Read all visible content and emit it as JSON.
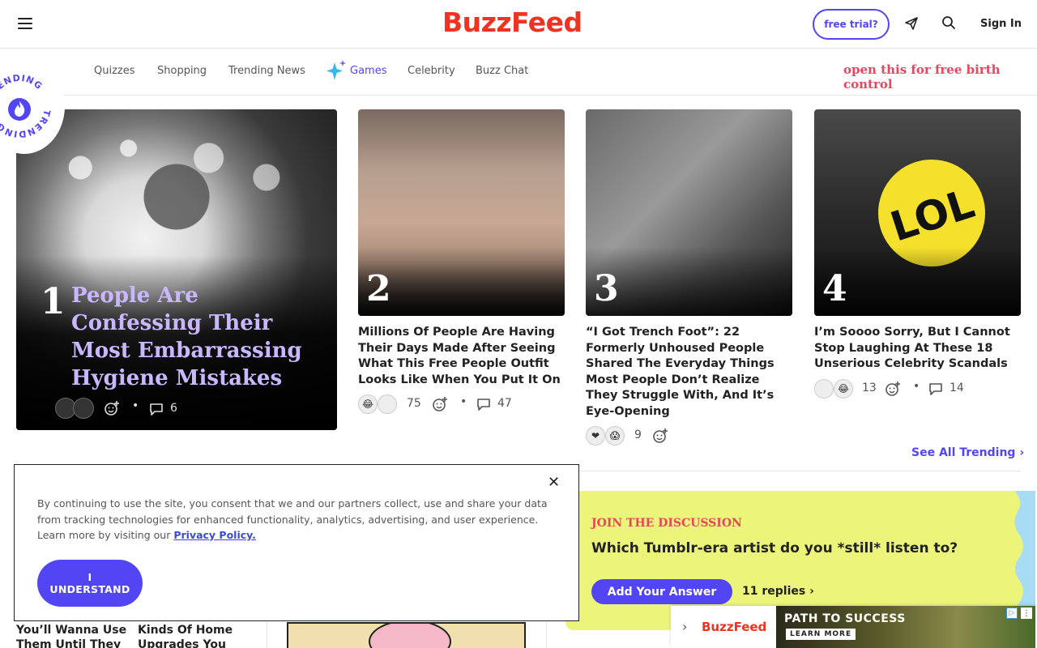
{
  "header": {
    "logo": "BuzzFeed",
    "trial_label": "free trial?",
    "signin_label": "Sign In"
  },
  "nav": {
    "items": [
      "Quizzes",
      "Shopping",
      "Trending News",
      "Games",
      "Celebrity",
      "Buzz Chat"
    ],
    "promo": "open this for free birth control"
  },
  "trending_badge": {
    "label": "TRENDING"
  },
  "posts": [
    {
      "rank": "1",
      "title": "People Are Confessing Their Most Embarrassing Hygiene Mistakes",
      "comments": "6"
    },
    {
      "rank": "2",
      "title": "Millions Of People Are Having Their Days Made After Seeing What This Free People Outfit Looks Like When You Put It On",
      "reactions": "75",
      "comments": "47"
    },
    {
      "rank": "3",
      "title": "“I Got Trench Foot”: 22 Formerly Unhoused People Shared The Everyday Things Most People Don’t Realize They Struggle With, And It’s Eye-Opening",
      "reactions": "9"
    },
    {
      "rank": "4",
      "title": "I’m Soooo Sorry, But I Cannot Stop Laughing At These 18 Unserious Celebrity Scandals",
      "reactions": "13",
      "comments": "14",
      "overlay": "LOL"
    }
  ],
  "see_all": "See All Trending",
  "discussion": {
    "kicker": "JOIN THE DISCUSSION",
    "question": "Which Tumblr-era artist do you *still* listen to?",
    "answer_label": "Add Your Answer",
    "replies": "11 replies"
  },
  "ad": {
    "brand": "BuzzFeed",
    "headline": "PATH TO SUCCESS",
    "cta": "LEARN MORE"
  },
  "cookie": {
    "text": "By continuing to use the site, you consent that we and our partners collect, use and share your data from tracking technologies for enhanced functionality, analytics, advertising, and user experience. Learn more by visiting our ",
    "link": "Privacy Policy.",
    "button_line1": "I",
    "button_line2": "UNDERSTAND"
  },
  "peek": {
    "left": "You’ll Wanna Use Them Until They",
    "right": "Kinds Of Home Upgrades You"
  },
  "colors": {
    "brand": "#ee3322",
    "accent": "#5246f4",
    "promo": "#e8455e",
    "discussion_bg": "#ecf57a"
  }
}
